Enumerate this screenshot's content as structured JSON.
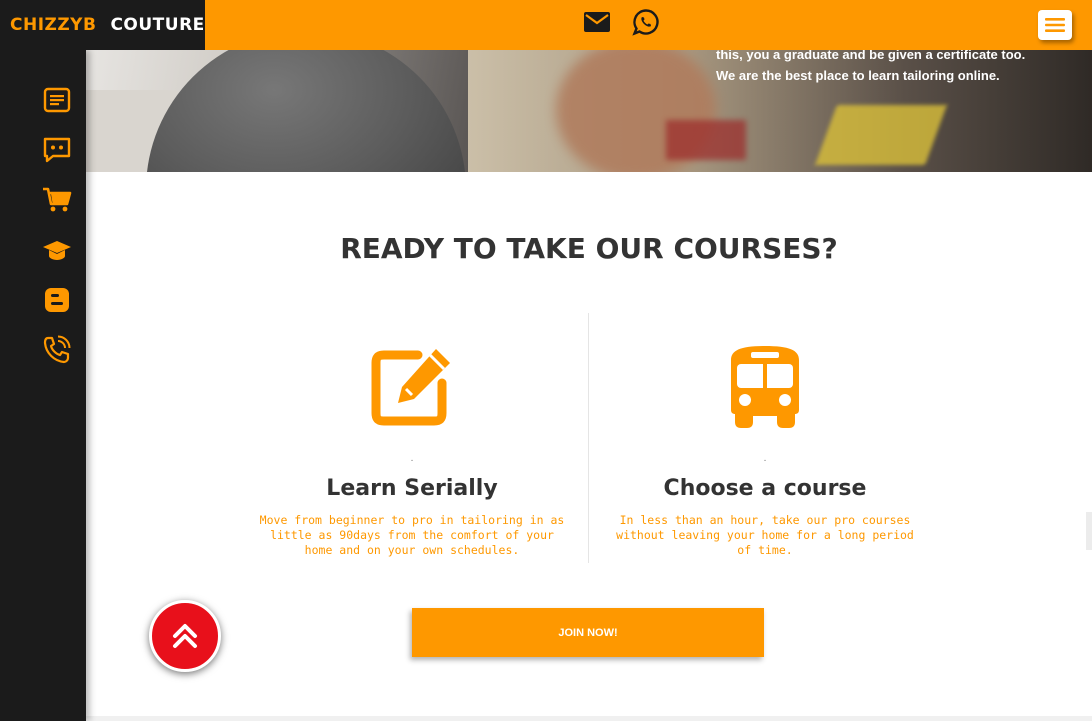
{
  "brand": {
    "part1": "CHIZZYB",
    "part2": "COUTURE"
  },
  "header": {
    "icons": [
      "mail-icon",
      "whatsapp-icon"
    ],
    "menu_icon": "hamburger-menu-icon"
  },
  "hero": {
    "text_line1": "this, you a graduate and be given a certificate too.",
    "text_line2": "We are the best place to learn tailoring online."
  },
  "sidebar": {
    "items": [
      {
        "icon": "article-icon"
      },
      {
        "icon": "chat-icon"
      },
      {
        "icon": "cart-icon"
      },
      {
        "icon": "graduation-cap-icon"
      },
      {
        "icon": "blogger-icon"
      },
      {
        "icon": "phone-icon"
      }
    ]
  },
  "section": {
    "title": "READY TO TAKE OUR COURSES?",
    "columns": [
      {
        "icon": "edit-icon",
        "dot": ".",
        "title": "Learn Serially",
        "description": "Move from beginner to pro in tailoring in as little as 90days from the comfort of your home and on your own schedules."
      },
      {
        "icon": "bus-icon",
        "dot": ".",
        "title": "Choose a course",
        "description": "In less than an hour, take our pro courses without leaving your home for a long period of time."
      }
    ],
    "cta_label": "JOIN NOW!"
  },
  "scroll_top": {
    "icon": "double-chevron-up-icon"
  },
  "colors": {
    "accent": "#fe9800",
    "dark": "#1b1b1b",
    "heading": "#333333",
    "scroll_button": "#e8101b"
  }
}
